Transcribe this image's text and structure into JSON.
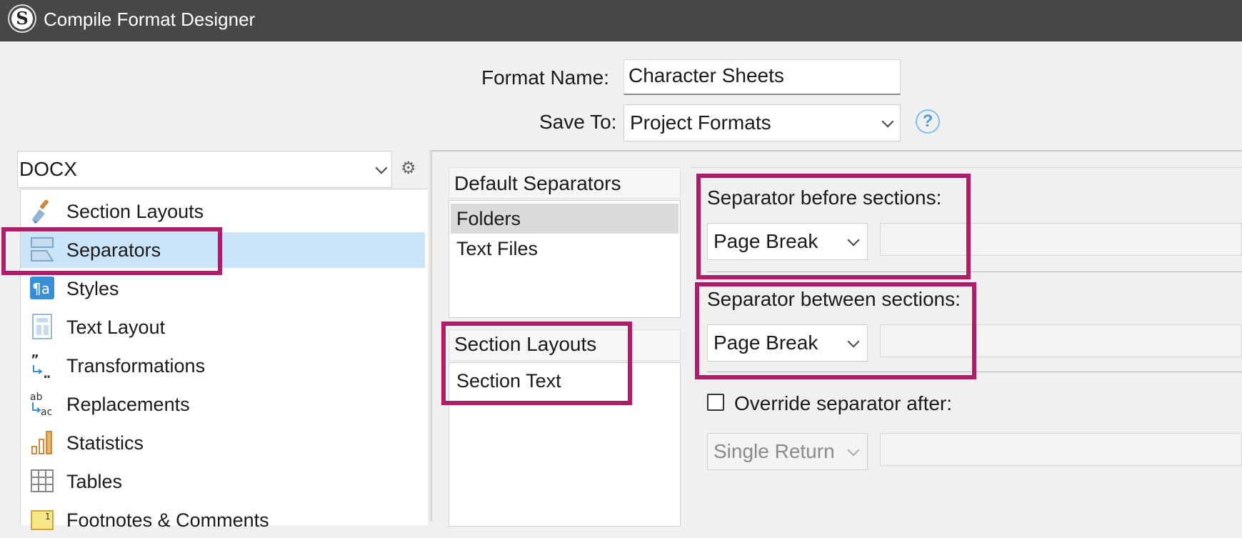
{
  "window": {
    "title": "Compile Format Designer",
    "logo_letter": "S"
  },
  "format_name": {
    "label": "Format Name:",
    "value": "Character Sheets"
  },
  "save_to": {
    "label": "Save To:",
    "value": "Project Formats"
  },
  "format_type": {
    "value": "DOCX"
  },
  "sidebar": {
    "items": [
      {
        "label": "Section Layouts",
        "icon": "brush-icon"
      },
      {
        "label": "Separators",
        "icon": "separators-icon",
        "selected": true
      },
      {
        "label": "Styles",
        "icon": "styles-icon"
      },
      {
        "label": "Text Layout",
        "icon": "text-layout-icon"
      },
      {
        "label": "Transformations",
        "icon": "transformations-icon"
      },
      {
        "label": "Replacements",
        "icon": "replacements-icon"
      },
      {
        "label": "Statistics",
        "icon": "statistics-icon"
      },
      {
        "label": "Tables",
        "icon": "tables-icon"
      },
      {
        "label": "Footnotes & Comments",
        "icon": "footnotes-icon"
      }
    ]
  },
  "default_separators": {
    "header": "Default Separators",
    "items": [
      {
        "label": "Folders",
        "selected": true
      },
      {
        "label": "Text Files"
      }
    ]
  },
  "section_layouts": {
    "header": "Section Layouts",
    "items": [
      {
        "label": "Section Text"
      }
    ]
  },
  "separator_before": {
    "label": "Separator before sections:",
    "value": "Page Break"
  },
  "separator_between": {
    "label": "Separator between sections:",
    "value": "Page Break"
  },
  "override_after": {
    "label": "Override separator after:",
    "value": "Single Return",
    "checked": false
  },
  "colors": {
    "titlebar": "#474747",
    "selection": "#cce4f7",
    "highlight": "#b01c6a",
    "help": "#4a9fd8"
  }
}
